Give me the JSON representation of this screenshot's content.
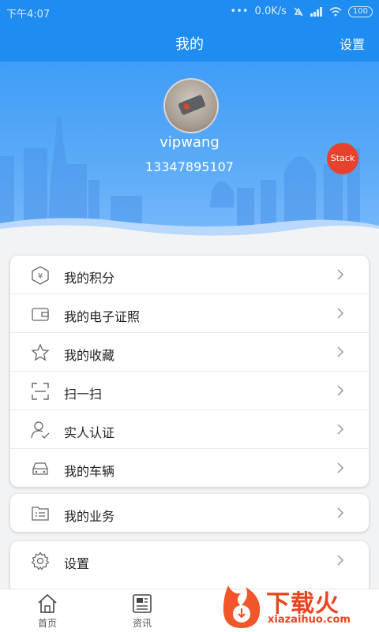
{
  "status_bar": {
    "time": "下午4:07",
    "speed": "0.0K/s",
    "battery": "100"
  },
  "top_bar": {
    "title": "我的",
    "settings_label": "设置"
  },
  "profile": {
    "username": "vipwang",
    "phone": "13347895107",
    "badge": "Stack"
  },
  "menu_main": [
    {
      "label": "我的积分",
      "icon": "points-hexagon-icon"
    },
    {
      "label": "我的电子证照",
      "icon": "wallet-icon"
    },
    {
      "label": "我的收藏",
      "icon": "star-icon"
    },
    {
      "label": "扫一扫",
      "icon": "scan-icon"
    },
    {
      "label": "实人认证",
      "icon": "person-verify-icon"
    },
    {
      "label": "我的车辆",
      "icon": "car-icon"
    }
  ],
  "menu_business": [
    {
      "label": "我的业务",
      "icon": "folder-list-icon"
    }
  ],
  "menu_settings": [
    {
      "label": "设置",
      "icon": "gear-icon"
    }
  ],
  "bottom_nav": [
    {
      "label": "首页",
      "icon": "home-icon"
    },
    {
      "label": "资讯",
      "icon": "news-icon"
    }
  ],
  "watermark": {
    "cn": "下载火",
    "en": "xiazaihuo.com"
  },
  "colors": {
    "primary": "#1f8cf1",
    "badge": "#e8412e",
    "watermark": "#e9441d"
  }
}
